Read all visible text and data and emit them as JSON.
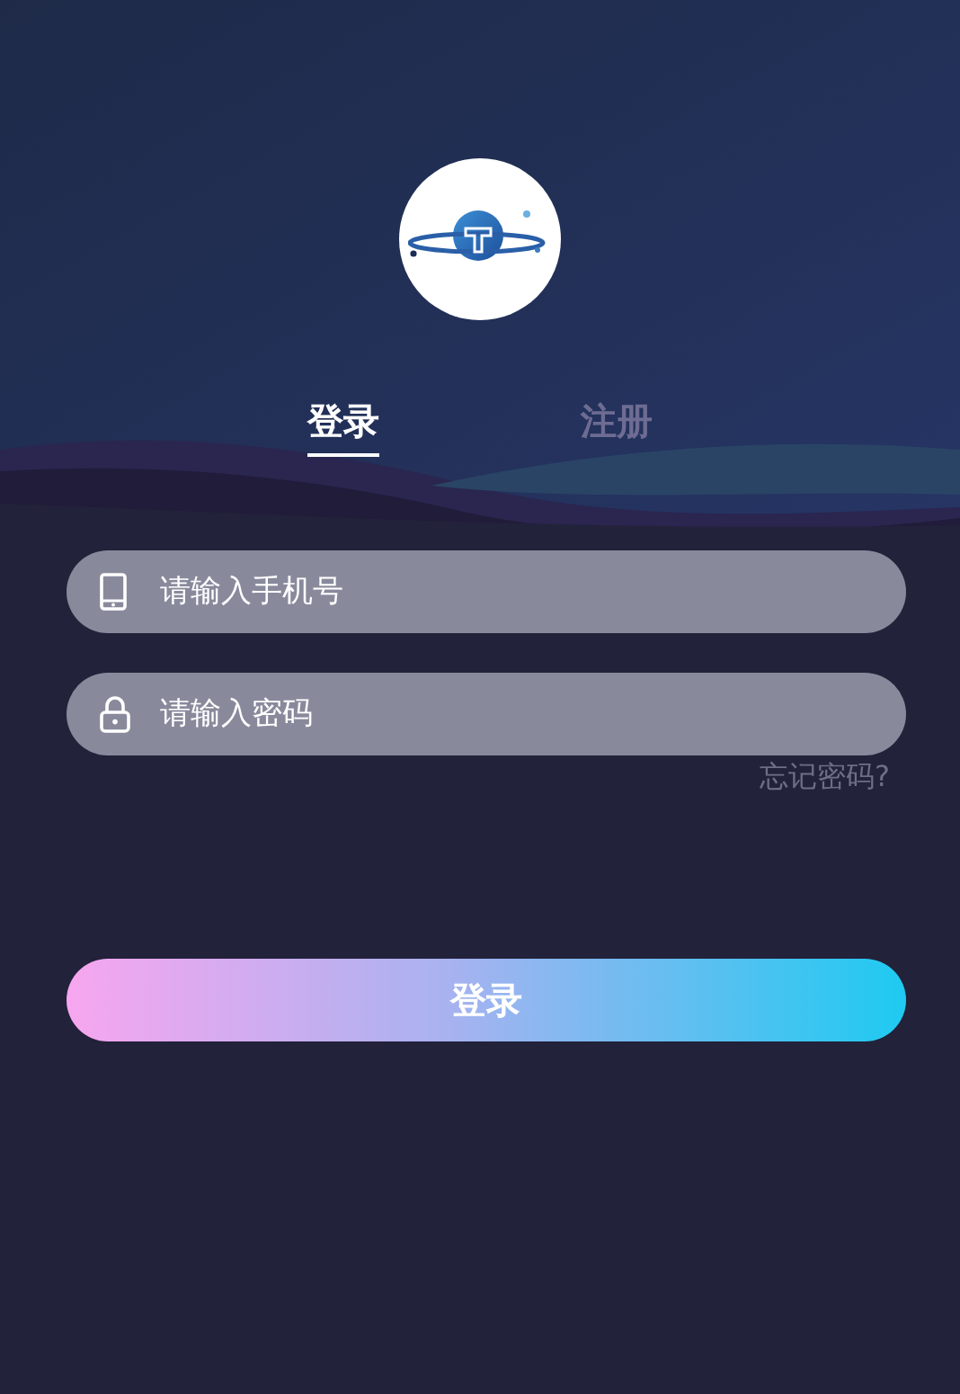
{
  "tabs": [
    {
      "label": "登录",
      "selected": true
    },
    {
      "label": "注册",
      "selected": false
    }
  ],
  "fields": [
    {
      "kind": "phone",
      "placeholder": "请输入手机号"
    },
    {
      "kind": "password",
      "placeholder": "请输入密码"
    }
  ],
  "forgot_link": "忘记密码?",
  "submit_button": "登录"
}
